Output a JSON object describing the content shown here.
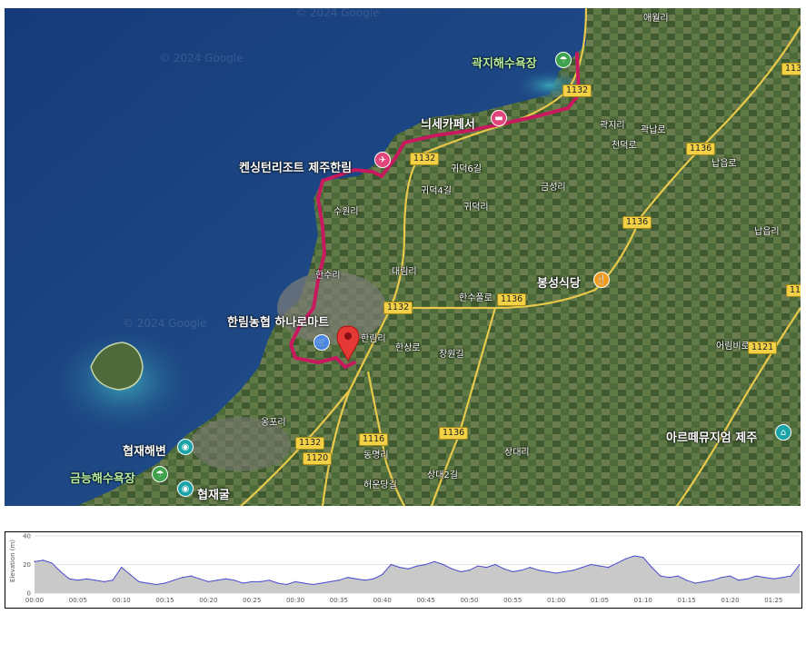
{
  "map": {
    "watermarks": [
      "© 2024 Google",
      "© 2024 Google",
      "© 2024 Google"
    ],
    "places": {
      "aewolri": "애월리",
      "gwakji_beach": "곽지해수욕장",
      "neuhcaffe": "늬세카페서",
      "kensington": "켄싱턴리조트 제주한림",
      "suwonri": "수원리",
      "gwideokri": "귀덕리",
      "gwideok6": "귀덕6길",
      "gwideok4": "귀덕4길",
      "geumseongri": "금성리",
      "gwakjiri": "곽지리",
      "gwakji_north": "곽납로",
      "cheondeokro": "천덕로",
      "napeupro": "납읍로",
      "napeupri": "납읍리",
      "daerimri": "대림리",
      "hansuri": "한수리",
      "hanhwan": "한수풀로",
      "hallim_mart": "한림농협 하나로마트",
      "hallimri": "한림리",
      "hansang": "한상로",
      "changdeok": "창원길",
      "bongseong": "봉성식당",
      "ongpori": "옹포리",
      "hyeopjae_beach": "협재해변",
      "geumneung_beach": "금능해수욕장",
      "hyeopjae_cave": "협재굴",
      "dongmyeongri": "동명리",
      "sangdaeri": "상대리",
      "artemu": "아르떼뮤지엄 제주",
      "sangdae2": "상대2길",
      "heoun": "허운당길",
      "eomdong": "어림비로"
    },
    "roads": [
      "1132",
      "1132",
      "1136",
      "1136",
      "1136",
      "1132",
      "1136",
      "1116",
      "1132",
      "1120",
      "1121",
      "1136",
      "1132"
    ]
  },
  "profile": {
    "y_axis_title": "Elevation (m)",
    "y_ticks": [
      "0",
      "20",
      "40"
    ],
    "x_ticks": [
      "00:00",
      "00:05",
      "00:10",
      "00:15",
      "00:20",
      "00:25",
      "00:30",
      "00:35",
      "00:40",
      "00:45",
      "00:50",
      "00:55",
      "01:00",
      "01:05",
      "01:10",
      "01:15",
      "01:20",
      "01:25"
    ]
  },
  "chart_data": {
    "type": "area",
    "xlabel": "",
    "ylabel": "Elevation (m)",
    "ylim": [
      0,
      40
    ],
    "x_unit": "minutes",
    "x": [
      0,
      1,
      2,
      3,
      4,
      5,
      6,
      7,
      8,
      9,
      10,
      11,
      12,
      13,
      14,
      15,
      16,
      17,
      18,
      19,
      20,
      21,
      22,
      23,
      24,
      25,
      26,
      27,
      28,
      29,
      30,
      31,
      32,
      33,
      34,
      35,
      36,
      37,
      38,
      39,
      40,
      41,
      42,
      43,
      44,
      45,
      46,
      47,
      48,
      49,
      50,
      51,
      52,
      53,
      54,
      55,
      56,
      57,
      58,
      59,
      60,
      61,
      62,
      63,
      64,
      65,
      66,
      67,
      68,
      69,
      70,
      71,
      72,
      73,
      74,
      75,
      76,
      77,
      78,
      79,
      80,
      81,
      82,
      83,
      84,
      85,
      86,
      87,
      88
    ],
    "series": [
      {
        "values": [
          22,
          23,
          21,
          15,
          10,
          9,
          10,
          9,
          8,
          9,
          18,
          13,
          8,
          7,
          6,
          7,
          9,
          11,
          12,
          10,
          8,
          9,
          10,
          9,
          7,
          8,
          8,
          9,
          7,
          6,
          8,
          7,
          6,
          7,
          8,
          9,
          11,
          10,
          9,
          10,
          13,
          20,
          18,
          17,
          19,
          20,
          22,
          20,
          17,
          15,
          16,
          19,
          18,
          20,
          17,
          15,
          16,
          18,
          16,
          15,
          14,
          15,
          16,
          18,
          20,
          19,
          18,
          21,
          24,
          26,
          25,
          18,
          12,
          11,
          12,
          9,
          7,
          8,
          9,
          11,
          12,
          9,
          10,
          12,
          11,
          10,
          11,
          12,
          20
        ]
      }
    ]
  }
}
